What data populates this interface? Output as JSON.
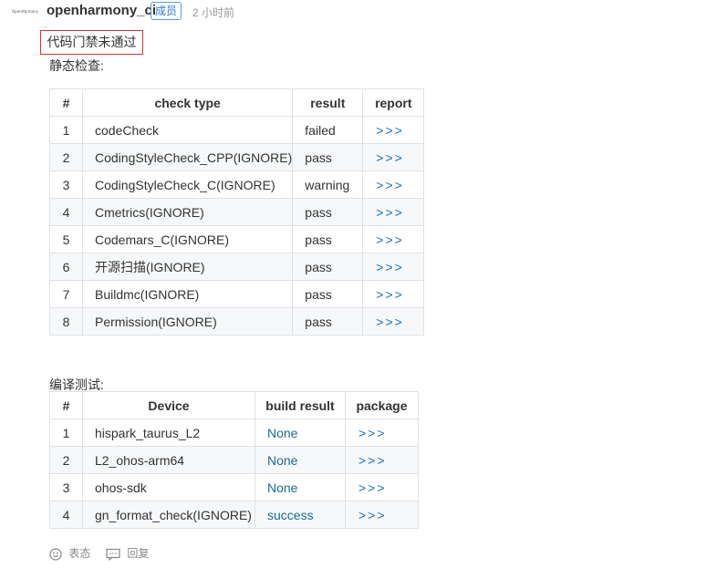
{
  "header": {
    "avatar_text": "OpenHarmony",
    "author": "openharmony_ci",
    "badge": "成员",
    "time": "2 小时前"
  },
  "gate_status": "代码门禁未通过",
  "static_check": {
    "title": "静态检查:",
    "columns": [
      "#",
      "check type",
      "result",
      "report"
    ],
    "rows": [
      {
        "idx": "1",
        "type": "codeCheck",
        "result": "failed",
        "report": ">>>"
      },
      {
        "idx": "2",
        "type": "CodingStyleCheck_CPP(IGNORE)",
        "result": "pass",
        "report": ">>>"
      },
      {
        "idx": "3",
        "type": "CodingStyleCheck_C(IGNORE)",
        "result": "warning",
        "report": ">>>"
      },
      {
        "idx": "4",
        "type": "Cmetrics(IGNORE)",
        "result": "pass",
        "report": ">>>"
      },
      {
        "idx": "5",
        "type": "Codemars_C(IGNORE)",
        "result": "pass",
        "report": ">>>"
      },
      {
        "idx": "6",
        "type": "开源扫描(IGNORE)",
        "result": "pass",
        "report": ">>>"
      },
      {
        "idx": "7",
        "type": "Buildmc(IGNORE)",
        "result": "pass",
        "report": ">>>"
      },
      {
        "idx": "8",
        "type": "Permission(IGNORE)",
        "result": "pass",
        "report": ">>>"
      }
    ]
  },
  "build_test": {
    "title": "编译测试:",
    "columns": [
      "#",
      "Device",
      "build result",
      "package"
    ],
    "rows": [
      {
        "idx": "1",
        "device": "hispark_taurus_L2",
        "result": "None",
        "package": ">>>"
      },
      {
        "idx": "2",
        "device": "L2_ohos-arm64",
        "result": "None",
        "package": ">>>"
      },
      {
        "idx": "3",
        "device": "ohos-sdk",
        "result": "None",
        "package": ">>>"
      },
      {
        "idx": "4",
        "device": "gn_format_check(IGNORE)",
        "result": "success",
        "package": ">>>"
      }
    ]
  },
  "footer": {
    "emoji_icon": "smiley-icon",
    "react_label": "表态",
    "reply_icon": "comment-icon",
    "reply_label": "回复"
  }
}
